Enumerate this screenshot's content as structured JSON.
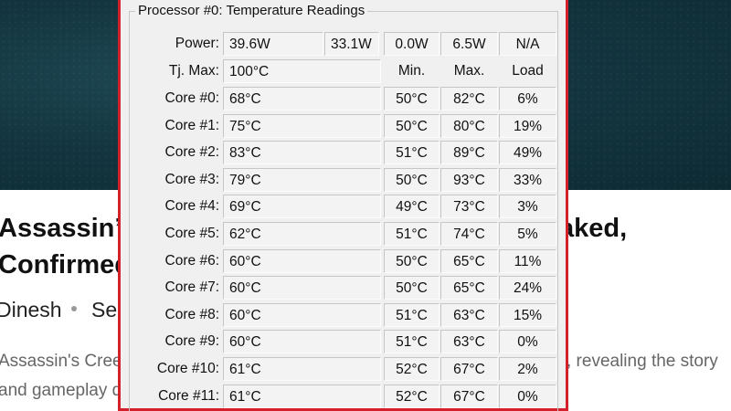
{
  "article": {
    "title_left": "Assassin’s",
    "title_right": "aked,",
    "title_line2": "Confirmed",
    "author": "Dinesh",
    "byline_rest": "Se",
    "excerpt_left": "Assassin's Cree",
    "excerpt_right": ", revealing the story",
    "excerpt_line2": "and gameplay d"
  },
  "panel": {
    "title": "Processor #0: Temperature Readings",
    "power": {
      "label": "Power:",
      "values": [
        "39.6W",
        "33.1W",
        "0.0W",
        "6.5W",
        "N/A"
      ]
    },
    "tjmax": {
      "label": "Tj. Max:",
      "value": "100°C"
    },
    "headers": {
      "min": "Min.",
      "max": "Max.",
      "load": "Load"
    },
    "cores": [
      {
        "label": "Core #0:",
        "temp": "68°C",
        "min": "50°C",
        "max": "82°C",
        "load": "6%"
      },
      {
        "label": "Core #1:",
        "temp": "75°C",
        "min": "50°C",
        "max": "80°C",
        "load": "19%"
      },
      {
        "label": "Core #2:",
        "temp": "83°C",
        "min": "51°C",
        "max": "89°C",
        "load": "49%"
      },
      {
        "label": "Core #3:",
        "temp": "79°C",
        "min": "50°C",
        "max": "93°C",
        "load": "33%"
      },
      {
        "label": "Core #4:",
        "temp": "69°C",
        "min": "49°C",
        "max": "73°C",
        "load": "3%"
      },
      {
        "label": "Core #5:",
        "temp": "62°C",
        "min": "51°C",
        "max": "74°C",
        "load": "5%"
      },
      {
        "label": "Core #6:",
        "temp": "60°C",
        "min": "50°C",
        "max": "65°C",
        "load": "11%"
      },
      {
        "label": "Core #7:",
        "temp": "60°C",
        "min": "50°C",
        "max": "65°C",
        "load": "24%"
      },
      {
        "label": "Core #8:",
        "temp": "60°C",
        "min": "51°C",
        "max": "63°C",
        "load": "15%"
      },
      {
        "label": "Core #9:",
        "temp": "60°C",
        "min": "51°C",
        "max": "63°C",
        "load": "0%"
      },
      {
        "label": "Core #10:",
        "temp": "61°C",
        "min": "52°C",
        "max": "67°C",
        "load": "2%"
      },
      {
        "label": "Core #11:",
        "temp": "61°C",
        "min": "52°C",
        "max": "67°C",
        "load": "0%"
      }
    ]
  }
}
